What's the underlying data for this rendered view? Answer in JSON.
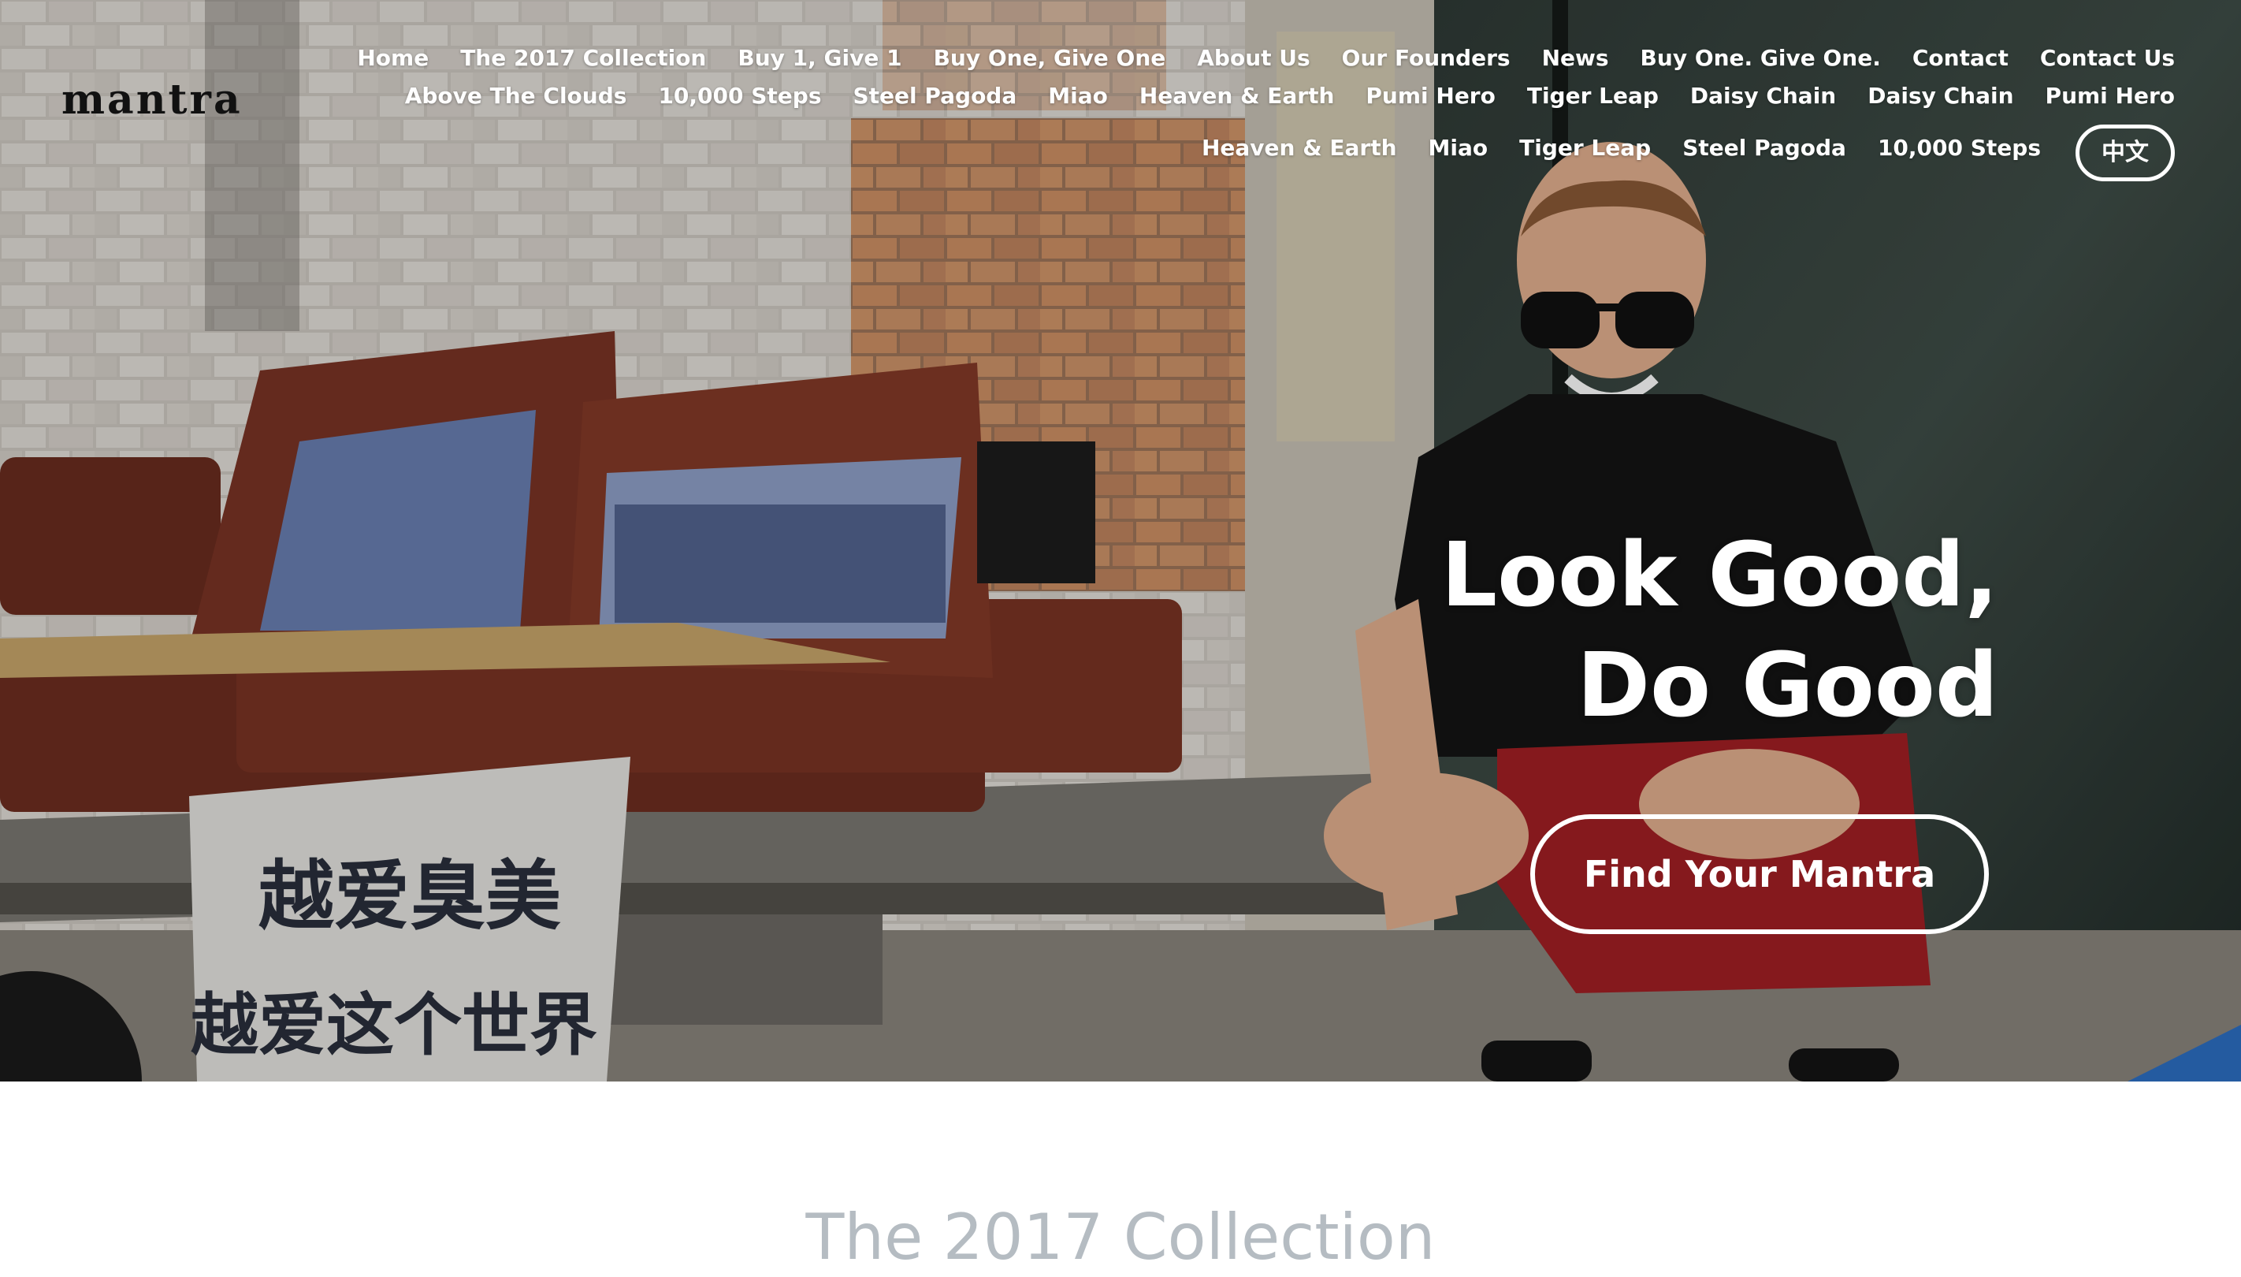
{
  "brand": {
    "logo_text": "mantra"
  },
  "nav": {
    "items": [
      "Home",
      "The 2017 Collection",
      "Buy 1, Give 1",
      "Buy One, Give One",
      "About Us",
      "Our Founders",
      "News",
      "Buy One. Give One.",
      "Contact",
      "Contact Us",
      "Above The Clouds",
      "10,000 Steps",
      "Steel Pagoda",
      "Miao",
      "Heaven & Earth",
      "Pumi Hero",
      "Tiger Leap",
      "Daisy Chain",
      "Daisy Chain",
      "Pumi Hero",
      "Heaven & Earth",
      "Miao",
      "Tiger Leap",
      "Steel Pagoda",
      "10,000 Steps"
    ],
    "language_button": "中文"
  },
  "hero": {
    "headline_line1": "Look Good,",
    "headline_line2": "Do Good",
    "cta_label": "Find Your Mantra",
    "tote_text_line1": "越爱臭美",
    "tote_text_line2": "越爱这个世界"
  },
  "section": {
    "title": "The 2017 Collection"
  },
  "colors": {
    "text_on_hero": "#ffffff",
    "section_title": "#b5bcc2",
    "page_background": "#ffffff"
  }
}
